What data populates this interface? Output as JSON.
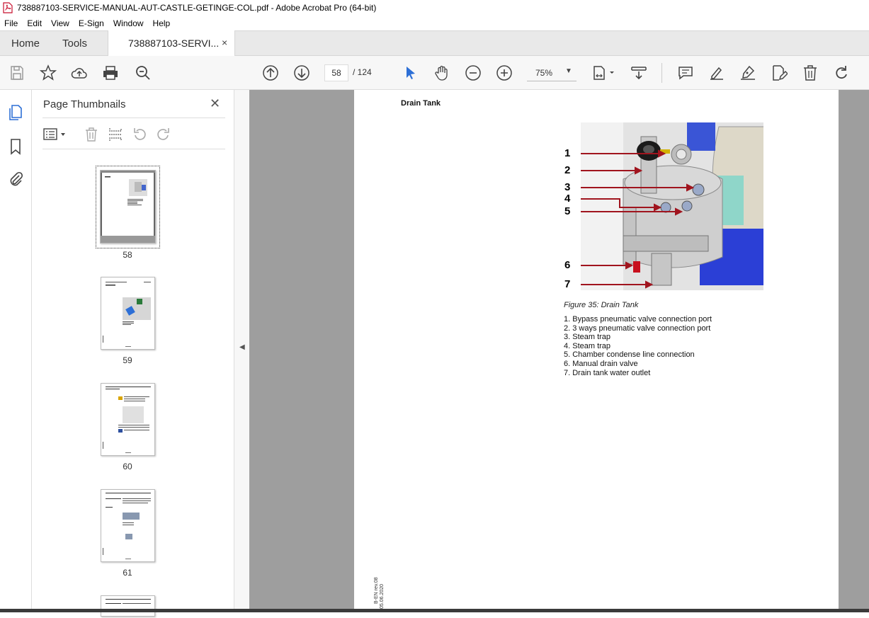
{
  "window": {
    "title": "738887103-SERVICE-MANUAL-AUT-CASTLE-GETINGE-COL.pdf - Adobe Acrobat Pro (64-bit)"
  },
  "menu": [
    "File",
    "Edit",
    "View",
    "E-Sign",
    "Window",
    "Help"
  ],
  "tabs": {
    "home": "Home",
    "tools": "Tools",
    "doc": "738887103-SERVI...",
    "close": "×"
  },
  "toolbar": {
    "page_current": "58",
    "page_total": "/ 124",
    "zoom": "75%"
  },
  "thumbnails_panel": {
    "title": "Page Thumbnails",
    "close": "✕",
    "pages": [
      "58",
      "59",
      "60",
      "61"
    ]
  },
  "document": {
    "heading": "Drain Tank",
    "figure_caption": "Figure 35: Drain Tank",
    "callouts": [
      "1",
      "2",
      "3",
      "4",
      "5",
      "6",
      "7"
    ],
    "legend": [
      "1. Bypass pneumatic valve connection port",
      "2. 3 ways pneumatic valve connection port",
      "3. Steam trap",
      "4. Steam trap",
      "5. Chamber condense line connection",
      "6. Manual drain valve",
      "7. Drain tank water outlet"
    ],
    "footer_line1": "B-EN rev.08",
    "footer_line2": "05.06.2020"
  },
  "colors": {
    "arrow": "#a0141e",
    "accent_blue": "#2d6fd6",
    "doc_bg": "#9e9e9e"
  }
}
